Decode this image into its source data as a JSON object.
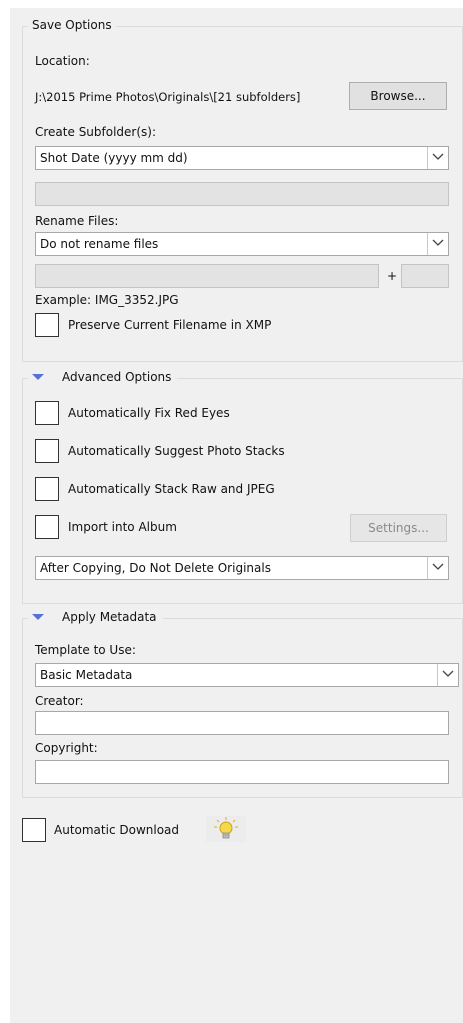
{
  "save_options": {
    "legend": "Save Options",
    "location_label": "Location:",
    "location_path": "J:\\2015 Prime Photos\\Originals\\[21 subfolders]",
    "browse_label": "Browse...",
    "create_subfolder_label": "Create Subfolder(s):",
    "subfolder_value": "Shot Date (yyyy mm dd)",
    "subfolder_custom_value": "",
    "rename_label": "Rename Files:",
    "rename_value": "Do not rename files",
    "rename_custom_value": "",
    "plus_label": "+",
    "rename_number_value": "",
    "example_text": "Example:  IMG_3352.JPG",
    "preserve_label": "Preserve Current Filename in XMP",
    "preserve_checked": false
  },
  "advanced_options": {
    "legend": "Advanced Options",
    "fix_red_eyes_label": "Automatically Fix Red Eyes",
    "suggest_stacks_label": "Automatically Suggest Photo Stacks",
    "stack_raw_jpeg_label": "Automatically Stack Raw and JPEG",
    "import_album_label": "Import into Album",
    "settings_label": "Settings...",
    "after_copying_value": "After Copying, Do Not Delete Originals"
  },
  "apply_metadata": {
    "legend": "Apply Metadata",
    "template_label": "Template to Use:",
    "template_value": "Basic Metadata",
    "creator_label": "Creator:",
    "creator_value": "",
    "copyright_label": "Copyright:",
    "copyright_value": ""
  },
  "footer": {
    "automatic_download_label": "Automatic Download"
  },
  "colors": {
    "panel_bg": "#f0f0f0",
    "expander_triangle": "#5b6fd8",
    "bulb": "#f5d94a"
  }
}
